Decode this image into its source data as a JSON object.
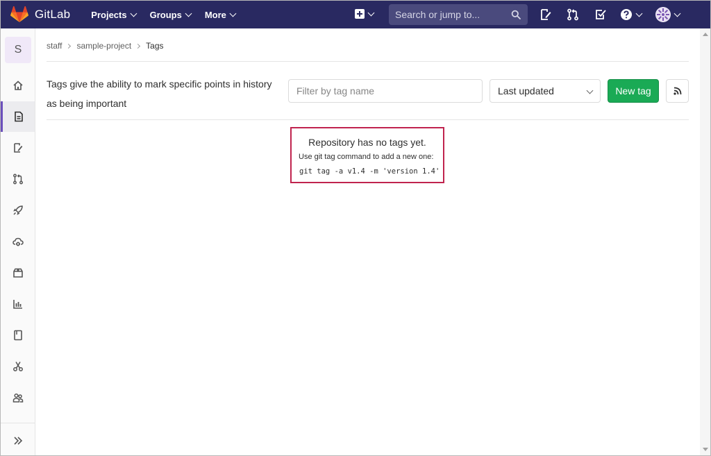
{
  "topnav": {
    "brand": "GitLab",
    "menu": [
      {
        "label": "Projects"
      },
      {
        "label": "Groups"
      },
      {
        "label": "More"
      }
    ],
    "search_placeholder": "Search or jump to...",
    "icons": [
      "plus-square-icon",
      "todo-doc-icon",
      "merge-request-icon",
      "check-square-icon",
      "help-icon",
      "user-avatar-icon"
    ]
  },
  "sidebar": {
    "project_initial": "S",
    "items": [
      {
        "name": "home-icon"
      },
      {
        "name": "repository-doc-icon",
        "active": true
      },
      {
        "name": "issues-icon"
      },
      {
        "name": "merge-requests-icon"
      },
      {
        "name": "rocket-icon"
      },
      {
        "name": "cloud-gear-icon"
      },
      {
        "name": "package-icon"
      },
      {
        "name": "analytics-chart-icon"
      },
      {
        "name": "wiki-book-icon"
      },
      {
        "name": "snippets-scissors-icon"
      },
      {
        "name": "members-icon"
      }
    ],
    "collapse_icon": "double-chevron-right-icon"
  },
  "breadcrumb": {
    "items": [
      "staff",
      "sample-project",
      "Tags"
    ]
  },
  "tags": {
    "description": "Tags give the ability to mark specific points in history as being important",
    "filter_placeholder": "Filter by tag name",
    "sort_label": "Last updated",
    "new_tag_label": "New tag",
    "rss_icon": "rss-icon"
  },
  "empty_state": {
    "title": "Repository has no tags yet.",
    "subtitle": "Use git tag command to add a new one:",
    "command": "git tag -a v1.4 -m 'version 1.4'"
  },
  "colors": {
    "nav_bg": "#292961",
    "accent_green": "#1aaa55",
    "active_border": "#6b4fbb",
    "highlight_box": "#c0234e"
  }
}
